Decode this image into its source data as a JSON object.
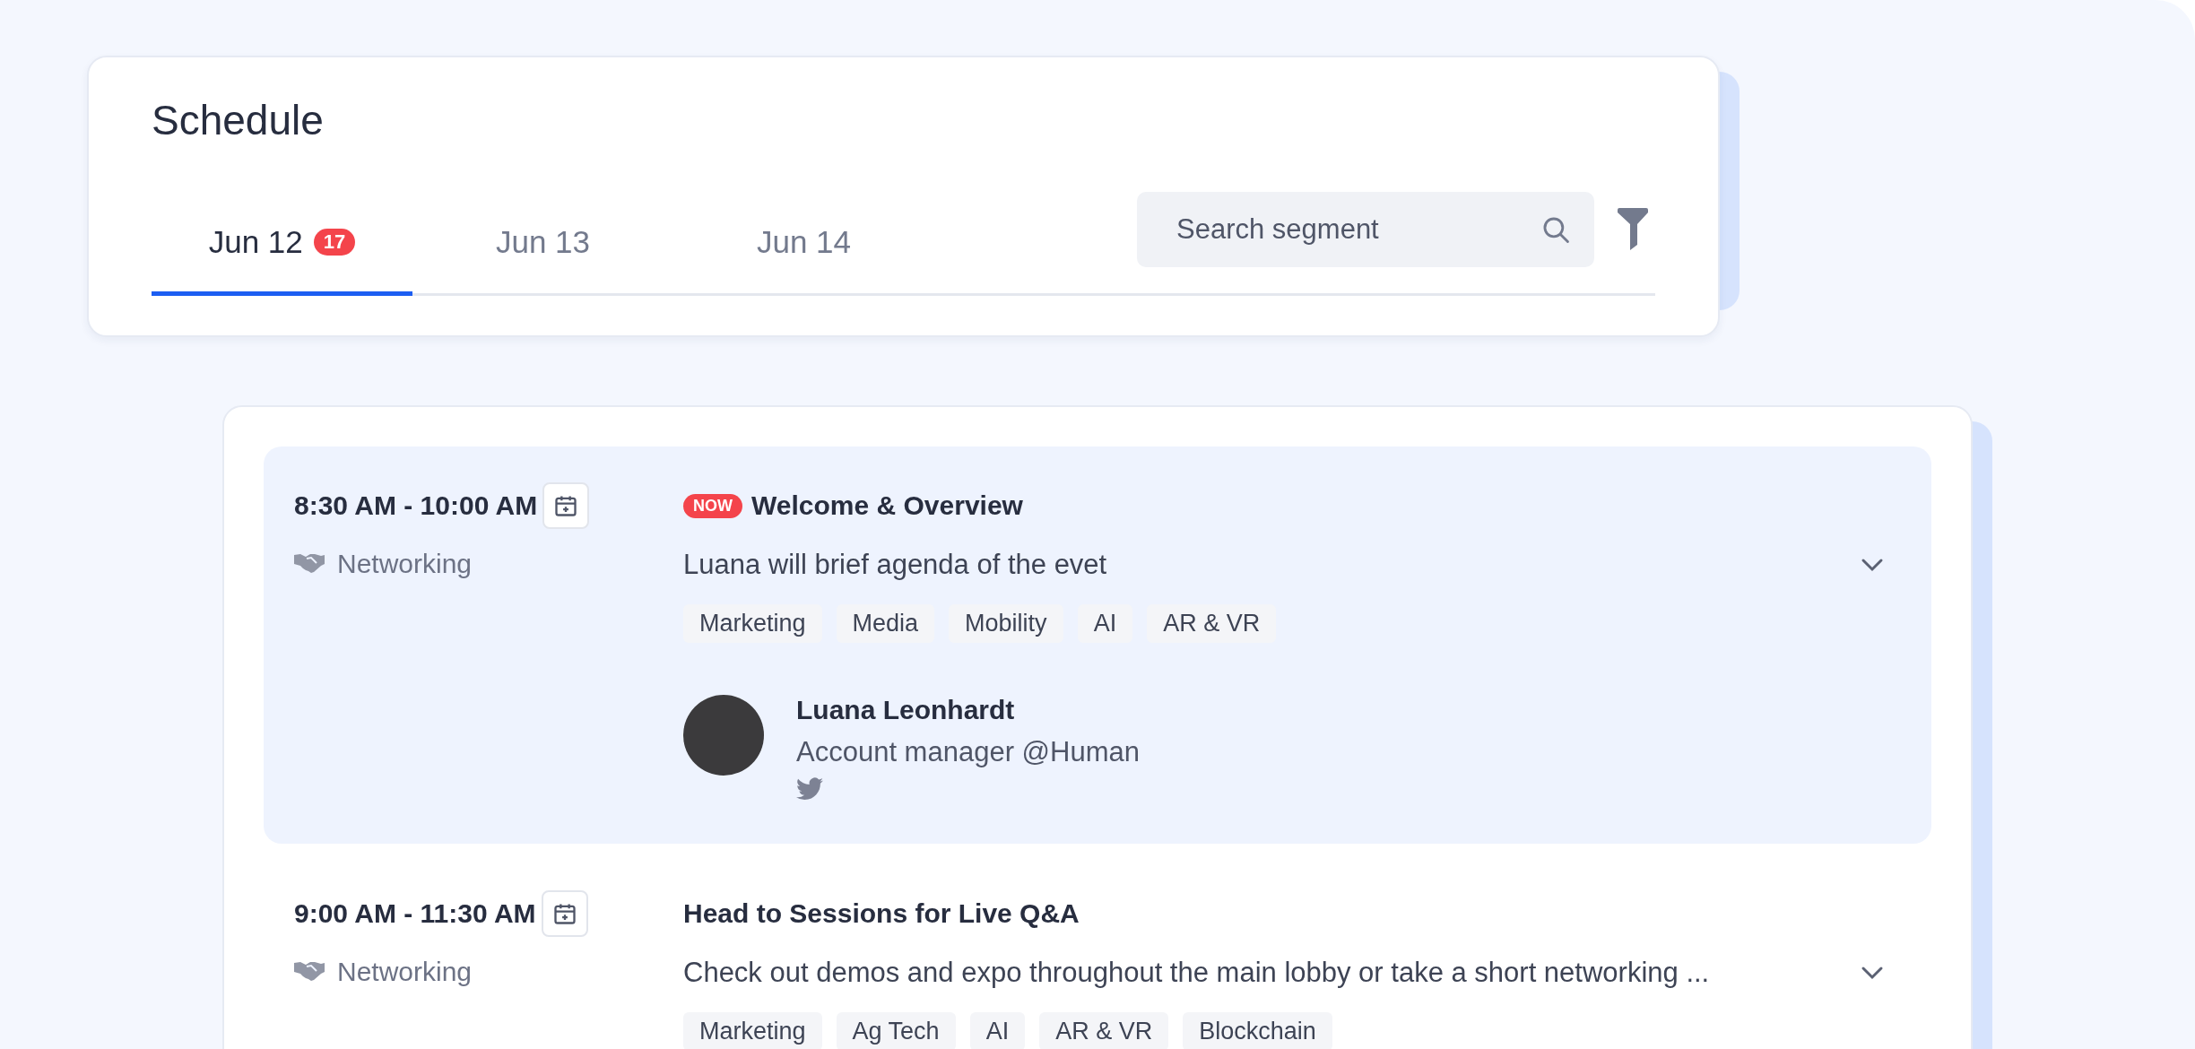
{
  "header": {
    "title": "Schedule"
  },
  "tabs": [
    {
      "label": "Jun 12",
      "count": "17",
      "selected": true
    },
    {
      "label": "Jun 13",
      "selected": false
    },
    {
      "label": "Jun 14",
      "selected": false
    }
  ],
  "search": {
    "placeholder": "Search segment"
  },
  "sessions": [
    {
      "time": "8:30 AM - 10:00 AM",
      "category": "Networking",
      "badge": "NOW",
      "title": "Welcome & Overview",
      "description": "Luana will brief agenda of the evet",
      "tags": [
        "Marketing",
        "Media",
        "Mobility",
        "AI",
        "AR & VR"
      ],
      "selected": true,
      "speaker": {
        "name": "Luana Leonhardt",
        "role": "Account manager @Human"
      }
    },
    {
      "time": "9:00 AM - 11:30 AM",
      "category": "Networking",
      "title": "Head to Sessions for Live Q&A",
      "description": "Check out demos and expo throughout the main lobby or take a short networking ...",
      "tags": [
        "Marketing",
        "Ag Tech",
        "AI",
        "AR & VR",
        "Blockchain"
      ],
      "selected": false
    }
  ]
}
